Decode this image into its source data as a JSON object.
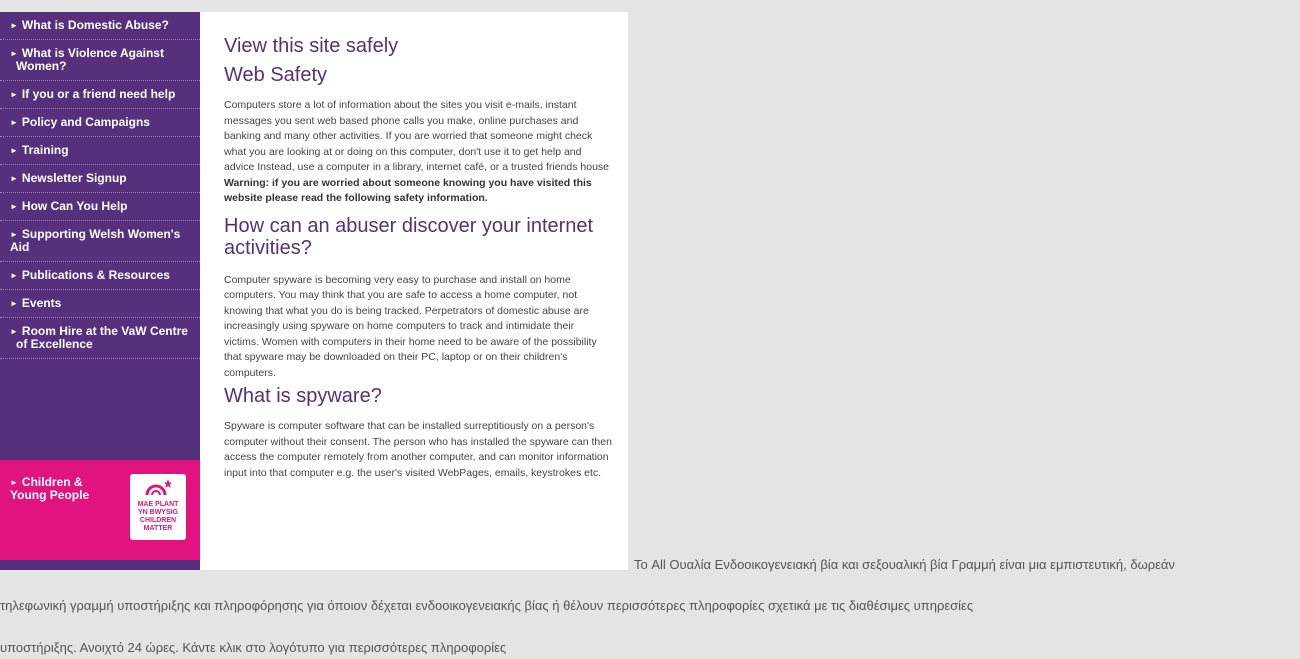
{
  "sidebar": {
    "items": [
      {
        "label": "What is Domestic Abuse?"
      },
      {
        "label": "What is Violence Against Women?"
      },
      {
        "label": "If you or a friend need help"
      },
      {
        "label": "Policy and Campaigns"
      },
      {
        "label": "Training"
      },
      {
        "label": "Newsletter Signup"
      },
      {
        "label": "How Can You Help"
      },
      {
        "label": "Supporting Welsh Women's Aid"
      },
      {
        "label": "Publications & Resources"
      },
      {
        "label": "Events"
      },
      {
        "label": "Room Hire at the VaW Centre of Excellence"
      }
    ],
    "children_box": {
      "label": "Children & Young People",
      "logo_lines": [
        "MAE PLANT",
        "YN BWYSIG",
        "CHILDREN",
        "MATTER"
      ]
    }
  },
  "content": {
    "title": "View this site safely",
    "sections": [
      {
        "heading": "Web Safety",
        "body": "Computers store a lot of information about the sites you visit e-mails, instant messages you sent web based phone calls you make, online purchases and banking and many other activities. If you are worried that someone might check what you are looking at or doing on this computer, don't use it to get help and advice Instead, use a computer in a library, internet café, or a trusted friends house",
        "warning": "Warning: if you are worried about someone knowing you have visited this website please read the following safety information."
      },
      {
        "heading": "How can an abuser discover your internet activities?",
        "body": "Computer spyware is becoming very easy to purchase and install on home computers. You may think that you are safe to access a home computer, not knowing that what you do is being tracked. Perpetrators of domestic abuse are increasingly using spyware on home computers to track and intimidate their victims. Women with computers in their home need to be aware of the possibility that spyware may be downloaded on their PC, laptop or on their children's computers."
      },
      {
        "heading": "What is spyware?",
        "body": "Spyware is computer software that can be installed surreptitiously on a person's computer without their consent. The person who has installed  the spyware can then access the computer remotely from another computer, and can monitor information input into that computer e.g. the user's visited WebPages, emails, keystrokes etc."
      }
    ]
  },
  "greek": {
    "line1": "Το All Ουαλία Ενδοοικογενειακή βία και σεξουαλική βία Γραμμή είναι μια εμπιστευτική, δωρεάν",
    "line2": "τηλεφωνική γραμμή υποστήριξης και πληροφόρησης για όποιον δέχεται ενδοοικογενειακής βίας ή θέλουν περισσότερες πληροφορίες σχετικά με τις διαθέσιμες υπηρεσίες",
    "line3": "υποστήριξης. Ανοιχτό 24 ώρες. Κάντε κλικ στο λογότυπο για περισσότερες πληροφορίες"
  },
  "colors": {
    "sidebar": "#56307c",
    "accent_pink": "#e1137e",
    "heading": "#56307c"
  }
}
